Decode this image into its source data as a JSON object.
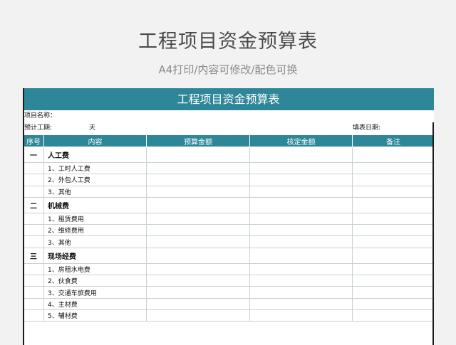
{
  "page": {
    "title": "工程项目资金预算表",
    "subtitle": "A4打印/内容可修改/配色可换"
  },
  "sheet": {
    "title": "工程项目资金预算表",
    "project_name_label": "项目名称：",
    "period_label": "预计工期:",
    "period_unit": "天",
    "fill_date_label": "填表日期:",
    "columns": [
      "序号",
      "内容",
      "预算金额",
      "核定金额",
      "备注"
    ],
    "rows": [
      {
        "seq": "一",
        "content": "人工费",
        "section": true
      },
      {
        "seq": "",
        "content": "1、工时人工费",
        "section": false
      },
      {
        "seq": "",
        "content": "2、外包人工费",
        "section": false
      },
      {
        "seq": "",
        "content": "3、其他",
        "section": false
      },
      {
        "seq": "二",
        "content": "机械费",
        "section": true
      },
      {
        "seq": "",
        "content": "1、租赁费用",
        "section": false
      },
      {
        "seq": "",
        "content": "2、维修费用",
        "section": false
      },
      {
        "seq": "",
        "content": "3、其他",
        "section": false
      },
      {
        "seq": "三",
        "content": "现场经费",
        "section": true
      },
      {
        "seq": "",
        "content": "1、房租水电费",
        "section": false
      },
      {
        "seq": "",
        "content": "2、伙食费",
        "section": false
      },
      {
        "seq": "",
        "content": "3、交通车旅费用",
        "section": false
      },
      {
        "seq": "",
        "content": "4、主材费",
        "section": false
      },
      {
        "seq": "",
        "content": "5、辅材费",
        "section": false
      }
    ]
  },
  "colors": {
    "header_teal": "#2e8799",
    "background": "#f2f2f2",
    "grid": "#c9d0d3"
  }
}
